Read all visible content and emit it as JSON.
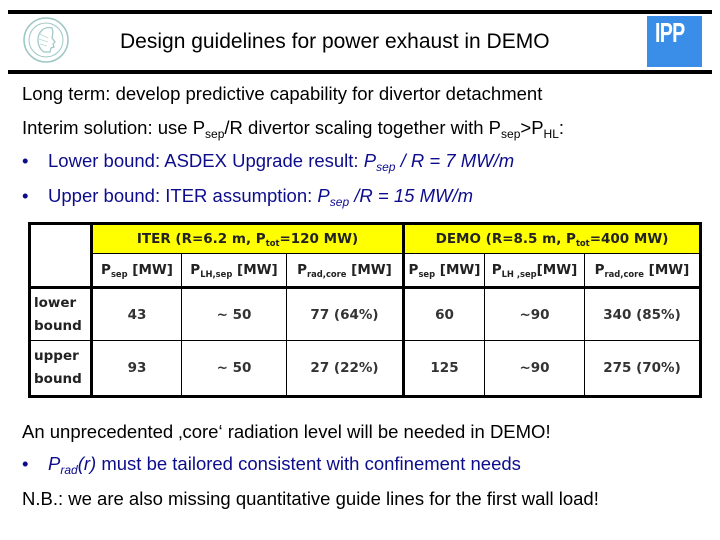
{
  "header": {
    "title": "Design guidelines for power exhaust in DEMO",
    "logo_left_icon": "minerva-head-logo",
    "logo_right_text": "IPP",
    "logo_right_color": "#3a8ee8"
  },
  "body": {
    "line1": "Long term: develop predictive capability for divertor detachment",
    "line2": {
      "prefix": "Interim solution: use P",
      "sub1": "sep",
      "mid": "/R divertor scaling together with P",
      "sub2": "sep",
      "gt": ">P",
      "sub3": "HL",
      "suffix": ":"
    },
    "bullet_glyph": "•",
    "bullet1": {
      "prefix": "Lower bound: ASDEX Upgrade result: ",
      "p": "P",
      "sub": "sep",
      "rest": " / R = 7 MW/m"
    },
    "bullet2": {
      "prefix": "Upper bound: ITER assumption: ",
      "p": "P",
      "sub": "sep",
      "rest": " /R = 15 MW/m"
    },
    "line5": "An unprecedented ‚core‘ radiation level will be needed in DEMO!",
    "bullet3": {
      "p": "P",
      "sub": "rad",
      "r": "(r)",
      "rest": " must be tailored consistent with confinement needs"
    },
    "line7": "N.B.: we are also missing quantitative guide lines for the first wall load!",
    "text_blue": "#0d0d8c"
  },
  "table": {
    "highlight_color": "#ffff00",
    "groups": [
      {
        "prefix": "ITER (R=6.2 m, P",
        "sub": "tot",
        "suffix": "=120 MW)"
      },
      {
        "prefix": "DEMO (R=8.5 m, P",
        "sub": "tot",
        "suffix": "=400 MW)"
      }
    ],
    "columns": [
      {
        "p": "P",
        "sub": "sep",
        "unit": " [MW]"
      },
      {
        "p": "P",
        "sub": "LH,sep",
        "unit": " [MW]"
      },
      {
        "p": "P",
        "sub": "rad,core",
        "unit": " [MW]"
      },
      {
        "p": "P",
        "sub": "sep",
        "unit": " [MW]"
      },
      {
        "p": "P",
        "sub": "LH ,sep",
        "unit": "[MW]"
      },
      {
        "p": "P",
        "sub": "rad,core",
        "unit": " [MW]"
      }
    ],
    "rows": [
      {
        "label_line1": "lower",
        "label_line2": "bound",
        "values": [
          "43",
          "~ 50",
          "77 (64%)",
          "60",
          "~90",
          "340 (85%)"
        ]
      },
      {
        "label_line1": "upper",
        "label_line2": "bound",
        "values": [
          "93",
          "~ 50",
          "27 (22%)",
          "125",
          "~90",
          "275 (70%)"
        ]
      }
    ]
  }
}
